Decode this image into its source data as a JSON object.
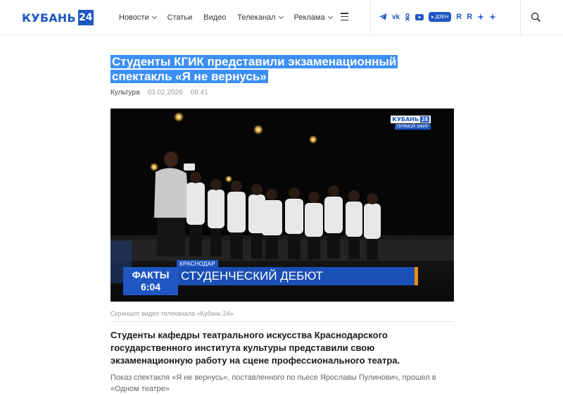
{
  "header": {
    "logo_text": "КУБАНЬ",
    "logo_num": "24",
    "nav": [
      "Новости",
      "Статьи",
      "Видео",
      "Телеканал",
      "Реклама"
    ],
    "nav_dropdown": [
      true,
      false,
      false,
      true,
      true
    ],
    "socials": [
      "telegram-icon",
      "vk-icon",
      "ok-icon",
      "youtube-icon",
      "dzen-icon",
      "rutube-icon",
      "rutube-icon",
      "star-icon",
      "star-icon"
    ],
    "dzen_label": "ДЗЕН",
    "rutube_label": "R"
  },
  "article": {
    "title": "Студенты КГИК представили экзаменационный спектакль «Я не вернусь»",
    "category": "Культура",
    "date": "03.02.2026",
    "time": "08:41",
    "caption": "Скриншот видео телеканала «Кубань 24»",
    "lead": "Студенты кафедры театрального искусства Краснодарского государственного института культуры представили свою экзаменационную работу на сцене профессионального театра.",
    "paragraph": "Показ спектакля «Я не вернусь», поставленного по пьесе Ярославы Пулинович, прошел в «Одном театре»"
  },
  "video": {
    "logo_text": "КУБАНЬ",
    "logo_num": "24",
    "live": "ПРЯМОЙ ЭФИР",
    "city": "КРАСНОДАР",
    "show": "ФАКТЫ",
    "show_time": "6:04",
    "headline": "СТУДЕНЧЕСКИЙ ДЕБЮТ"
  },
  "colors": {
    "brand": "#1f56c2",
    "highlight": "#3c8ff5",
    "accent_orange": "#f28c13"
  }
}
